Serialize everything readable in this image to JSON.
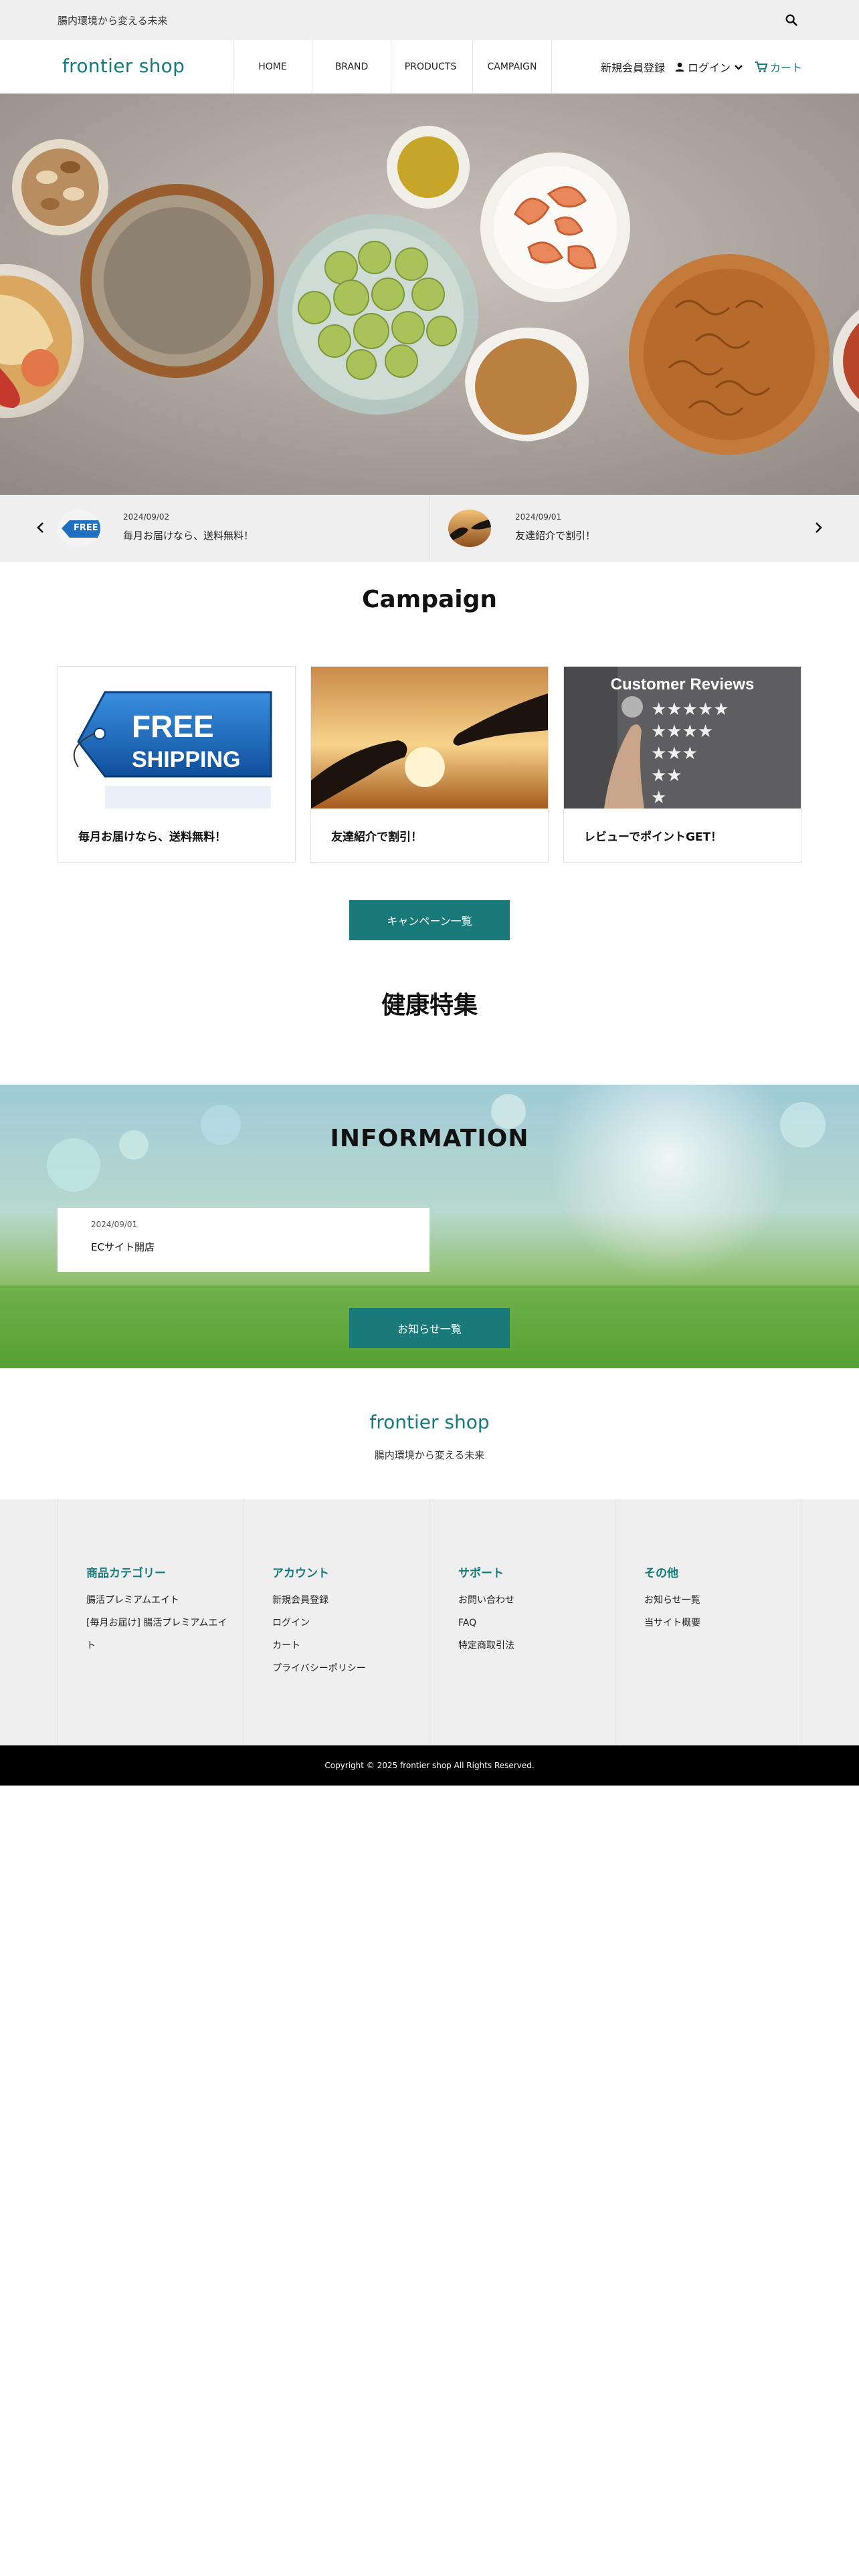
{
  "topbar": {
    "tagline": "腸内環境から変える未来",
    "search_icon": "search-icon"
  },
  "header": {
    "logo": "frontier shop",
    "nav": [
      "HOME",
      "BRAND",
      "PRODUCTS",
      "CAMPAIGN"
    ],
    "signup": "新規会員登録",
    "login": "ログイン",
    "cart": "カート",
    "accent_color": "#137b7c"
  },
  "slider": {
    "items": [
      {
        "date": "2024/09/02",
        "title": "毎月お届けなら、送料無料！",
        "thumb_text": "FREE SHIPPING"
      },
      {
        "date": "2024/09/01",
        "title": "友達紹介で割引！"
      }
    ]
  },
  "campaign": {
    "title": "Campaign",
    "cards": [
      {
        "label": "毎月お届けなら、送料無料！",
        "img_line1": "FREE",
        "img_line2": "SHIPPING"
      },
      {
        "label": "友達紹介で割引！"
      },
      {
        "label": "レビューでポイントGET！",
        "img_text": "Customer Reviews"
      }
    ],
    "button": "キャンペーン一覧"
  },
  "health": {
    "title": "健康特集"
  },
  "information": {
    "title": "INFORMATION",
    "items": [
      {
        "date": "2024/09/01",
        "title": "ECサイト開店"
      }
    ],
    "button": "お知らせ一覧"
  },
  "footer": {
    "brand": "frontier shop",
    "tagline": "腸内環境から変える未来",
    "columns": [
      {
        "heading": "商品カテゴリー",
        "links": [
          "腸活プレミアムエイト",
          "[毎月お届け] 腸活プレミアムエイ",
          "ト"
        ]
      },
      {
        "heading": "アカウント",
        "links": [
          "新規会員登録",
          "ログイン",
          "カート",
          "プライバシーポリシー"
        ]
      },
      {
        "heading": "サポート",
        "links": [
          "お問い合わせ",
          "FAQ",
          "特定商取引法"
        ]
      },
      {
        "heading": "その他",
        "links": [
          "お知らせ一覧",
          "当サイト概要"
        ]
      }
    ],
    "copyright": "Copyright © 2025 frontier shop All Rights Reserved."
  }
}
